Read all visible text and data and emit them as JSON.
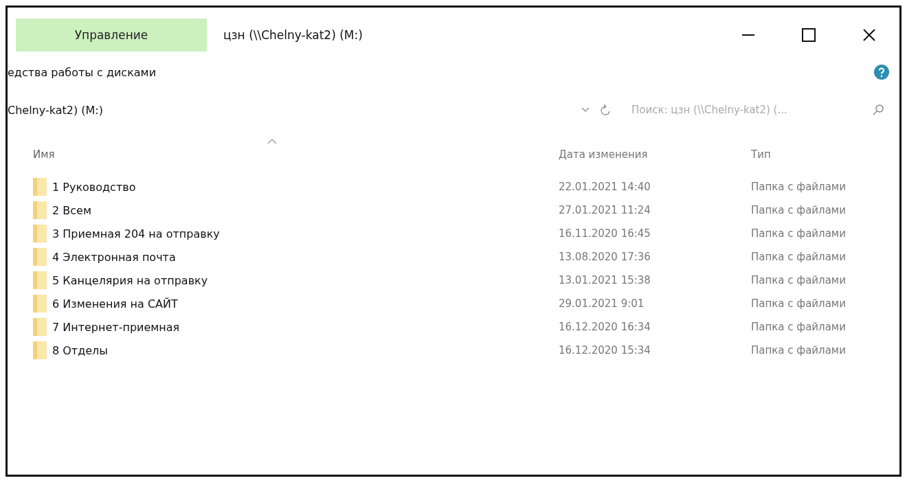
{
  "window": {
    "title": "цзн (\\\\Chelny-kat2) (M:)",
    "context_tab": {
      "label": "Управление",
      "selected": true
    }
  },
  "ribbon": {
    "group_label": "едства работы с дисками"
  },
  "address_bar": {
    "path": "Chelny-kat2) (M:)"
  },
  "search": {
    "placeholder": "Поиск: цзн (\\\\Chelny-kat2) (..."
  },
  "table": {
    "columns": [
      {
        "label": "Имя",
        "sorted": true
      },
      {
        "label": "Дата изменения",
        "sorted": false
      },
      {
        "label": "Тип",
        "sorted": false
      }
    ],
    "rows": [
      {
        "name": "1 Руководство",
        "date": "22.01.2021 14:40",
        "type": "Папка с файлами"
      },
      {
        "name": "2 Всем",
        "date": "27.01.2021 11:24",
        "type": "Папка с файлами"
      },
      {
        "name": "3 Приемная 204 на отправку",
        "date": "16.11.2020 16:45",
        "type": "Папка с файлами"
      },
      {
        "name": "4 Электронная почта",
        "date": "13.08.2020 17:36",
        "type": "Папка с файлами"
      },
      {
        "name": "5 Канцелярия на отправку",
        "date": "13.01.2021 15:38",
        "type": "Папка с файлами"
      },
      {
        "name": "6 Изменения на САЙТ",
        "date": "29.01.2021 9:01",
        "type": "Папка с файлами"
      },
      {
        "name": "7 Интернет-приемная",
        "date": "16.12.2020 16:34",
        "type": "Папка с файлами"
      },
      {
        "name": "8 Отделы",
        "date": "16.12.2020 15:34",
        "type": "Папка с файлами"
      }
    ]
  }
}
